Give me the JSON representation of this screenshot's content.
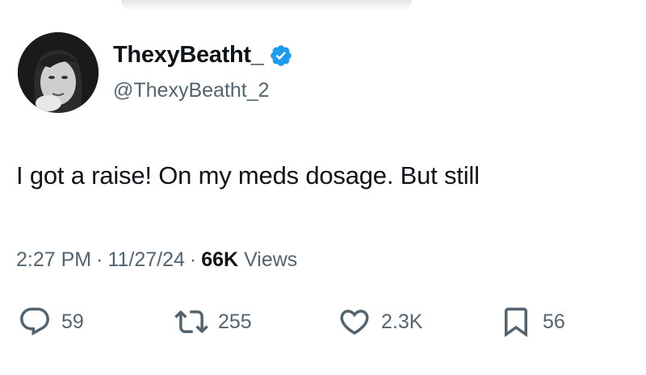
{
  "user": {
    "display_name": "ThexyBeatht_",
    "handle": "@ThexyBeatht_2",
    "verified": true
  },
  "tweet": {
    "text": "I got a raise! On my meds dosage. But still"
  },
  "meta": {
    "time": "2:27 PM",
    "separator": "·",
    "date": "11/27/24",
    "views_count": "66K",
    "views_label": "Views"
  },
  "actions": {
    "replies": "59",
    "retweets": "255",
    "likes": "2.3K",
    "bookmarks": "56"
  },
  "colors": {
    "verified_blue": "#1d9bf0",
    "text_primary": "#0f1419",
    "text_secondary": "#536471"
  },
  "icons": {
    "reply": "reply-icon",
    "retweet": "retweet-icon",
    "like": "like-icon",
    "bookmark": "bookmark-icon",
    "verified": "verified-badge-icon"
  }
}
